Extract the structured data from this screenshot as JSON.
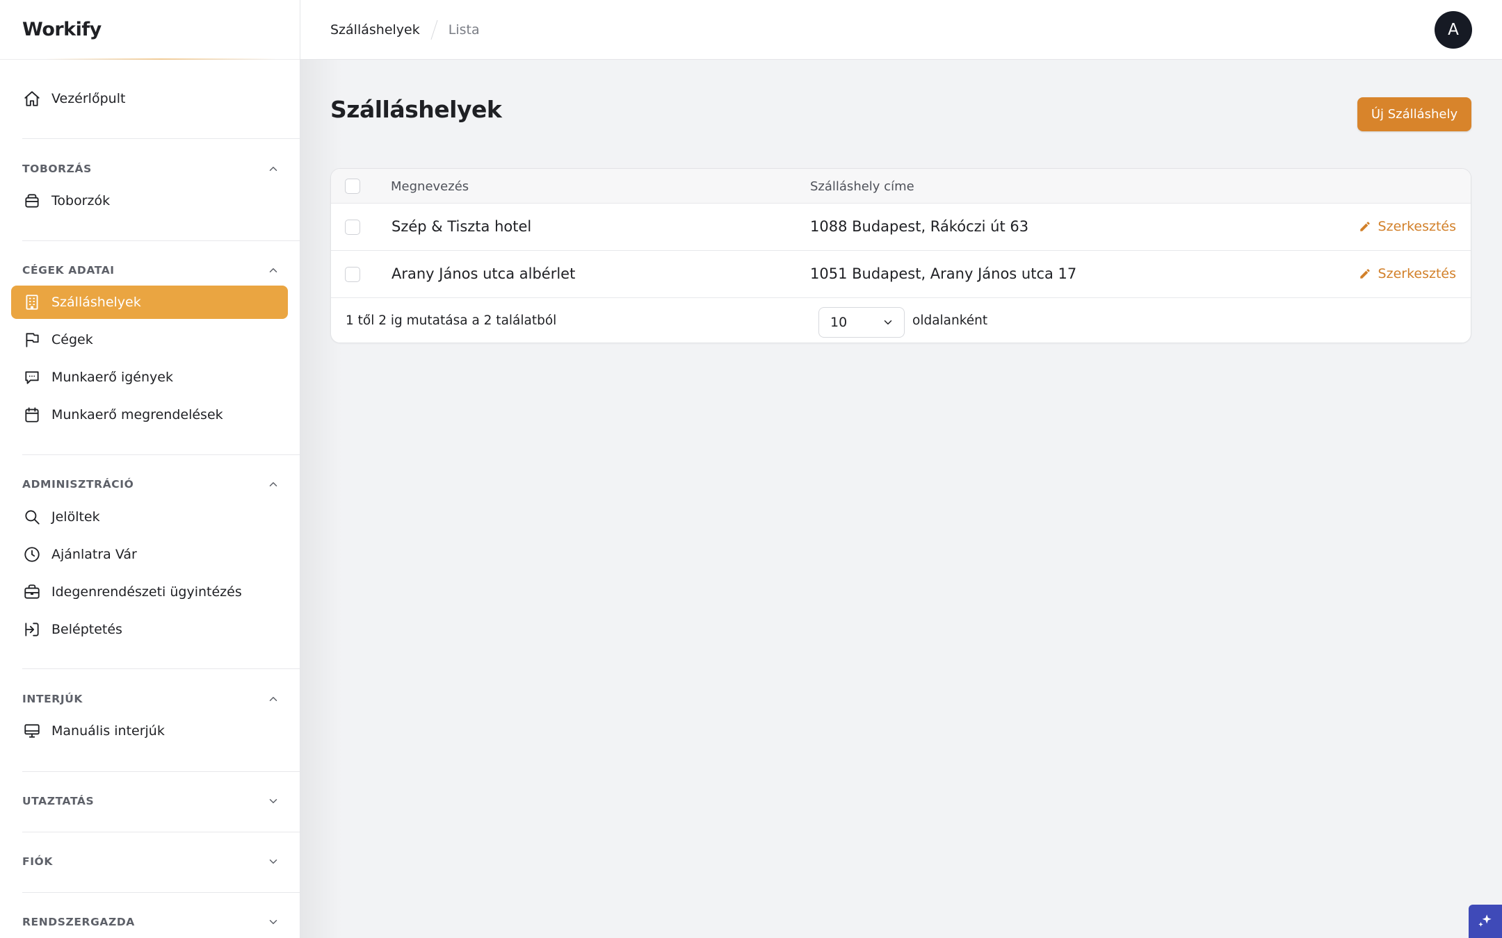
{
  "app": {
    "brand": "Workify"
  },
  "breadcrumb": {
    "current": "Szálláshelyek",
    "sub": "Lista"
  },
  "user": {
    "avatar_initial": "A"
  },
  "sidebar": {
    "dashboard": {
      "label": "Vezérlőpult",
      "icon": "home-icon"
    },
    "sections": [
      {
        "title": "TOBORZÁS",
        "expanded": true,
        "items": [
          {
            "label": "Toborzók",
            "icon": "box-icon"
          }
        ]
      },
      {
        "title": "CÉGEK ADATAI",
        "expanded": true,
        "items": [
          {
            "label": "Szálláshelyek",
            "icon": "building-icon",
            "active": true
          },
          {
            "label": "Cégek",
            "icon": "flag-icon"
          },
          {
            "label": "Munkaerő igények",
            "icon": "chat-icon"
          },
          {
            "label": "Munkaerő megrendelések",
            "icon": "calendar-icon"
          }
        ]
      },
      {
        "title": "ADMINISZTRÁCIÓ",
        "expanded": true,
        "items": [
          {
            "label": "Jelöltek",
            "icon": "search-icon"
          },
          {
            "label": "Ajánlatra Vár",
            "icon": "clock-icon"
          },
          {
            "label": "Idegenrendészeti ügyintézés",
            "icon": "briefcase-icon"
          },
          {
            "label": "Beléptetés",
            "icon": "login-icon"
          }
        ]
      },
      {
        "title": "INTERJÚK",
        "expanded": true,
        "items": [
          {
            "label": "Manuális interjúk",
            "icon": "monitor-icon"
          }
        ]
      },
      {
        "title": "UTAZTATÁS",
        "expanded": false,
        "items": []
      },
      {
        "title": "FIÓK",
        "expanded": false,
        "items": []
      },
      {
        "title": "RENDSZERGAZDA",
        "expanded": false,
        "items": []
      }
    ]
  },
  "main": {
    "title": "Szálláshelyek",
    "new_button": "Új Szálláshely",
    "table": {
      "columns": [
        "Megnevezés",
        "Szálláshely címe"
      ],
      "rows": [
        {
          "name": "Szép & Tiszta hotel",
          "address": "1088 Budapest, Rákóczi út 63",
          "action": "Szerkesztés"
        },
        {
          "name": "Arany János utca albérlet",
          "address": "1051 Budapest, Arany János utca 17",
          "action": "Szerkesztés"
        }
      ],
      "summary": "1 től 2 ig mutatása a 2 találatból",
      "per_page_value": "10",
      "per_page_label": "oldalanként"
    }
  },
  "colors": {
    "accent": "#eaa541",
    "button": "#d8842b",
    "link": "#d2802a",
    "avatar": "#161a24"
  }
}
